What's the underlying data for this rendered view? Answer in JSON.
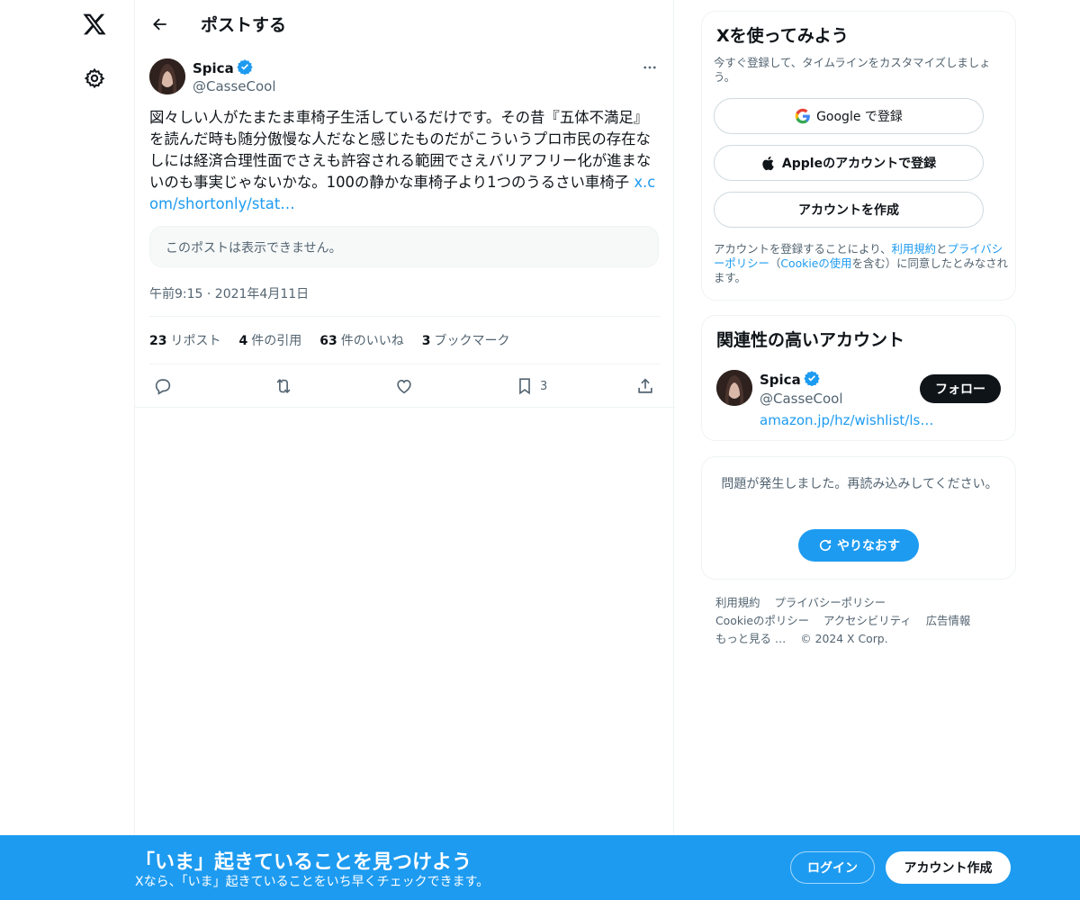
{
  "header": {
    "title": "ポストする"
  },
  "post": {
    "author_name": "Spica",
    "author_handle": "@CasseCool",
    "text": "図々しい人がたまたま車椅子生活しているだけです。その昔『五体不満足』を読んだ時も随分傲慢な人だなと感じたものだがこういうプロ市民の存在なしには経済合理性面でさえも許容される範囲でさえバリアフリー化が進まないのも事実じゃないかな。100の静かな車椅子より1つのうるさい車椅子 ",
    "link": "x.com/shortonly/stat…",
    "unavailable_notice": "このポストは表示できません。",
    "timestamp": "午前9:15 · 2021年4月11日",
    "stats": [
      {
        "count": "23",
        "label": "リポスト"
      },
      {
        "count": "4",
        "label": "件の引用"
      },
      {
        "count": "63",
        "label": "件のいいね"
      },
      {
        "count": "3",
        "label": "ブックマーク"
      }
    ],
    "bookmark_count": "3"
  },
  "signup_card": {
    "title": "Xを使ってみよう",
    "subtitle": "今すぐ登録して、タイムラインをカスタマイズしましょう。",
    "google_label": "Google で登録",
    "apple_label": "Appleのアカウントで登録",
    "create_label": "アカウントを作成",
    "legal_prefix": "アカウントを登録することにより、",
    "legal_terms": "利用規約",
    "legal_and": "と",
    "legal_privacy": "プライバシーポリシー",
    "legal_paren_open": "（",
    "legal_cookie": "Cookieの使用",
    "legal_suffix": "を含む）に同意したとみなされます。"
  },
  "related_card": {
    "title": "関連性の高いアカウント",
    "name": "Spica",
    "handle": "@CasseCool",
    "link": "amazon.jp/hz/wishlist/ls…",
    "follow_label": "フォロー"
  },
  "error_card": {
    "message": "問題が発生しました。再読み込みしてください。",
    "retry_label": "やりなおす"
  },
  "footer": {
    "links": [
      "利用規約",
      "プライバシーポリシー",
      "Cookieのポリシー",
      "アクセシビリティ",
      "広告情報",
      "もっと見る …",
      "© 2024 X Corp."
    ]
  },
  "banner": {
    "title": "「いま」起きていることを見つけよう",
    "subtitle": "Xなら、「いま」起きていることをいち早くチェックできます。",
    "login_label": "ログイン",
    "signup_label": "アカウント作成"
  },
  "colors": {
    "accent": "#1d9bf0",
    "text": "#0f1419",
    "secondary": "#536471",
    "border": "#eff3f4"
  }
}
